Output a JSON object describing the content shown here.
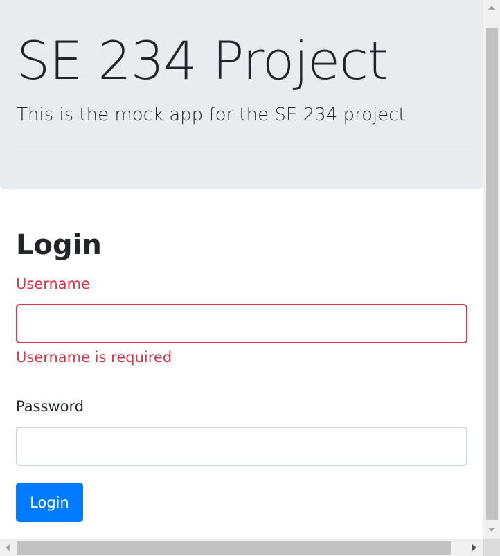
{
  "jumbotron": {
    "title": "SE 234 Project",
    "lead": "This is the mock app for the SE 234 project"
  },
  "login": {
    "title": "Login",
    "username_label": "Username",
    "username_value": "",
    "username_error": "Username is required",
    "password_label": "Password",
    "password_value": "",
    "submit_label": "Login"
  },
  "colors": {
    "jumbotron_bg": "#e9ecef",
    "error": "#dc3545",
    "primary": "#007bff",
    "text": "#212529",
    "input_border": "#ced4da"
  }
}
